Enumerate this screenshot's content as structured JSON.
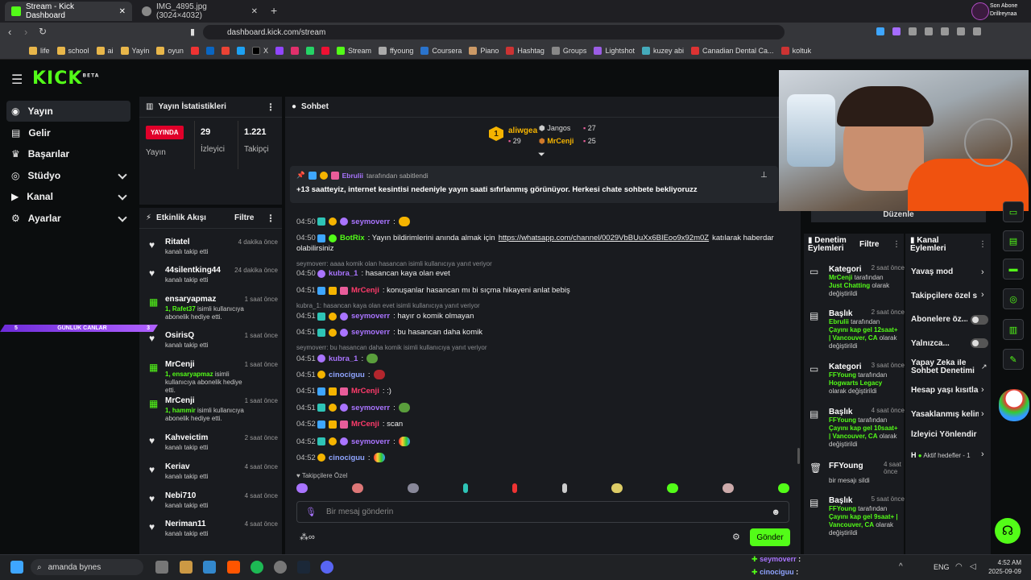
{
  "browser": {
    "tabs": [
      {
        "title": "Stream - Kick Dashboard",
        "active": true
      },
      {
        "title": "IMG_4895.jpg (3024×4032)",
        "active": false
      }
    ],
    "url": "dashboard.kick.com/stream",
    "bookmarks": [
      "life",
      "school",
      "ai",
      "Yayin",
      "oyun",
      "X",
      "Stream",
      "ffyoung",
      "Coursera",
      "Piano",
      "Hashtag",
      "Groups",
      "Lightshot",
      "kuzey abi",
      "Canadian Dental Ca...",
      "koltuk"
    ],
    "profile": {
      "line1": "Son Abone",
      "line2": "Drillreynaa"
    }
  },
  "logo": "KICK",
  "logo_sup": "BETA",
  "sidebar": {
    "items": [
      {
        "label": "Yayın",
        "icon": "broadcast-icon",
        "active": true
      },
      {
        "label": "Gelir",
        "icon": "revenue-icon"
      },
      {
        "label": "Başarılar",
        "icon": "trophy-icon"
      },
      {
        "label": "Stüdyo",
        "icon": "studio-icon"
      },
      {
        "label": "Kanal",
        "icon": "channel-icon"
      },
      {
        "label": "Ayarlar",
        "icon": "gear-icon"
      }
    ]
  },
  "stats": {
    "title": "Yayın İstatistikleri",
    "live_badge": "YAYINDA",
    "live_label": "Yayın",
    "viewers_value": "29",
    "viewers_label": "İzleyici",
    "followers_value": "1.221",
    "followers_label": "Takipçi"
  },
  "overlay_bar": {
    "left": "5",
    "text": "GÜNLÜK CANLAR",
    "right": "3"
  },
  "events": {
    "title": "Etkinlik Akışı",
    "filter": "Filtre",
    "items": [
      {
        "name": "Ritatel",
        "time": "4 dakika önce",
        "desc": "kanalı takip etti",
        "type": "follow"
      },
      {
        "name": "44silentking44",
        "time": "24 dakika önce",
        "desc": "kanalı takip etti",
        "type": "follow"
      },
      {
        "name": "ensaryapmaz",
        "time": "1 saat önce",
        "desc_hl": "1, Rafet37",
        "desc": "isimli kullanıcıya abonelik hediye etti.",
        "type": "gift"
      },
      {
        "name": "OsirisQ",
        "time": "1 saat önce",
        "desc": "kanalı takip etti",
        "type": "follow"
      },
      {
        "name": "MrCenji",
        "time": "1 saat önce",
        "desc_hl": "1, ensaryapmaz",
        "desc": "isimli kullanıcıya abonelik hediye etti.",
        "type": "gift"
      },
      {
        "name": "MrCenji",
        "time": "1 saat önce",
        "desc_hl": "1, hammir",
        "desc": "isimli kullanıcıya abonelik hediye etti.",
        "type": "gift"
      },
      {
        "name": "Kahveictim",
        "time": "2 saat önce",
        "desc": "kanalı takip etti",
        "type": "follow"
      },
      {
        "name": "Keriav",
        "time": "4 saat önce",
        "desc": "kanalı takip etti",
        "type": "follow"
      },
      {
        "name": "Nebi710",
        "time": "4 saat önce",
        "desc": "kanalı takip etti",
        "type": "follow"
      },
      {
        "name": "Neriman11",
        "time": "4 saat önce",
        "desc": "kanalı takip etti",
        "type": "follow"
      }
    ]
  },
  "chat": {
    "title": "Sohbet",
    "leaders": [
      {
        "rank": "1",
        "name": "aliwgea",
        "value": "29"
      },
      {
        "name": "Jangos",
        "value": "27"
      },
      {
        "name": "MrCenji",
        "value": "25"
      }
    ],
    "pinned_by": "Ebrulii",
    "pinned_suffix": "tarafından sabitlendi",
    "pinned_text": "+13 saatteyiz, internet kesintisi nedeniyle yayın saati sıfırlanmış görünüyor. Herkesi chate sohbete bekliyoruzz",
    "messages": [
      {
        "time": "04:50",
        "user": "seymoverr",
        "color": "#a974ff",
        "text": ":"
      },
      {
        "time": "04:50",
        "user": "BotRix",
        "color": "#53fc18",
        "text": ": Yayın bildirimlerini anında almak için",
        "link": "https://whatsapp.com/channel/0029VbBUuXx6BIEoo9x92m0Z",
        "text2": "katılarak haberdar",
        "text3": "olabilirsiniz"
      },
      {
        "reply": "seymoverr: aaaa komik olan hasancan isimli kullanıcıya yanıt veriyor"
      },
      {
        "time": "04:50",
        "user": "kubra_1",
        "color": "#a974ff",
        "text": ": hasancan kaya olan evet"
      },
      {
        "time": "04:51",
        "user": "MrCenji",
        "color": "#ff3b6b",
        "text": ": konuşanlar hasancan mı bi sıçma hikayeni anlat bebiş"
      },
      {
        "reply": "kubra_1: hasancan kaya olan evet isimli kullanıcıya yanıt veriyor"
      },
      {
        "time": "04:51",
        "user": "seymoverr",
        "color": "#a974ff",
        "text": ": hayır o komik olmayan"
      },
      {
        "time": "04:51",
        "user": "seymoverr",
        "color": "#a974ff",
        "text": ": bu hasancan daha komik"
      },
      {
        "reply": "seymoverr: bu hasancan daha komik isimli kullanıcıya yanıt veriyor"
      },
      {
        "time": "04:51",
        "user": "kubra_1",
        "color": "#a974ff",
        "text": ":"
      },
      {
        "time": "04:51",
        "user": "cinociguu",
        "color": "#8fa4ff",
        "text": ":"
      },
      {
        "time": "04:51",
        "user": "MrCenji",
        "color": "#ff3b6b",
        "text": ": :)"
      },
      {
        "time": "04:51",
        "user": "seymoverr",
        "color": "#a974ff",
        "text": ":"
      },
      {
        "time": "04:52",
        "user": "MrCenji",
        "color": "#ff3b6b",
        "text": ": scan"
      },
      {
        "time": "04:52",
        "user": "seymoverr",
        "color": "#a974ff",
        "text": ":"
      },
      {
        "time": "04:52",
        "user": "cinociguu",
        "color": "#8fa4ff",
        "text": ":"
      }
    ],
    "followers_only": "Takipçilere Özel",
    "placeholder": "Bir mesaj gönderin",
    "send": "Gönder"
  },
  "webcam_button": "Düzenle",
  "mod": {
    "title": "Denetim Eylemleri",
    "filter": "Filtre",
    "items": [
      {
        "title": "Kategori",
        "time": "2 saat önce",
        "who": "MrCenji",
        "mid": "tarafından",
        "val": "Just Chatting",
        "end": "olarak değiştirildi"
      },
      {
        "title": "Başlık",
        "time": "2 saat önce",
        "who": "Ebrulii",
        "mid": "tarafından",
        "val": "Çayını kap gel 12saat+ | Vancouver, CA",
        "end": "olarak değiştirildi"
      },
      {
        "title": "Kategori",
        "time": "3 saat önce",
        "who": "FFYoung",
        "mid": "tarafından",
        "val": "Hogwarts Legacy",
        "end": "olarak değiştirildi"
      },
      {
        "title": "Başlık",
        "time": "4 saat önce",
        "who": "FFYoung",
        "mid": "tarafından",
        "val": "Çayını kap gel 10saat+ | Vancouver, CA",
        "end": "olarak değiştirildi"
      },
      {
        "title": "FFYoung",
        "time": "4 saat önce",
        "desc": "bir mesajı sildi"
      },
      {
        "title": "Başlık",
        "time": "5 saat önce",
        "who": "FFYoung",
        "mid": "tarafından",
        "val": "Çayını kap gel 9saat+ | Vancouver, CA",
        "end": "olarak değiştirildi"
      }
    ]
  },
  "channel": {
    "title": "Kanal Eylemleri",
    "items": [
      "Yavaş mod",
      "Takipçilere özel so",
      "Abonelere öz...",
      "Yalnızca...",
      "Yapay Zeka ile Sohbet Denetimi",
      "Hesap yaşı kısıtlar",
      "Yasaklanmış kelim",
      "İzleyici Yönlendir",
      "H",
      "Aktif hedefler - 1"
    ]
  },
  "taskbar": {
    "search": "amanda bynes",
    "lang": "ENG",
    "time": "4:52 AM",
    "date": "2025-09-09",
    "feed": [
      {
        "user": "seymoverr",
        "text": ":"
      },
      {
        "user": "cinociguu",
        "text": ":"
      }
    ]
  },
  "colors": {
    "accent": "#53fc18",
    "panel": "#191b1f",
    "bg": "#0b0d0e"
  }
}
